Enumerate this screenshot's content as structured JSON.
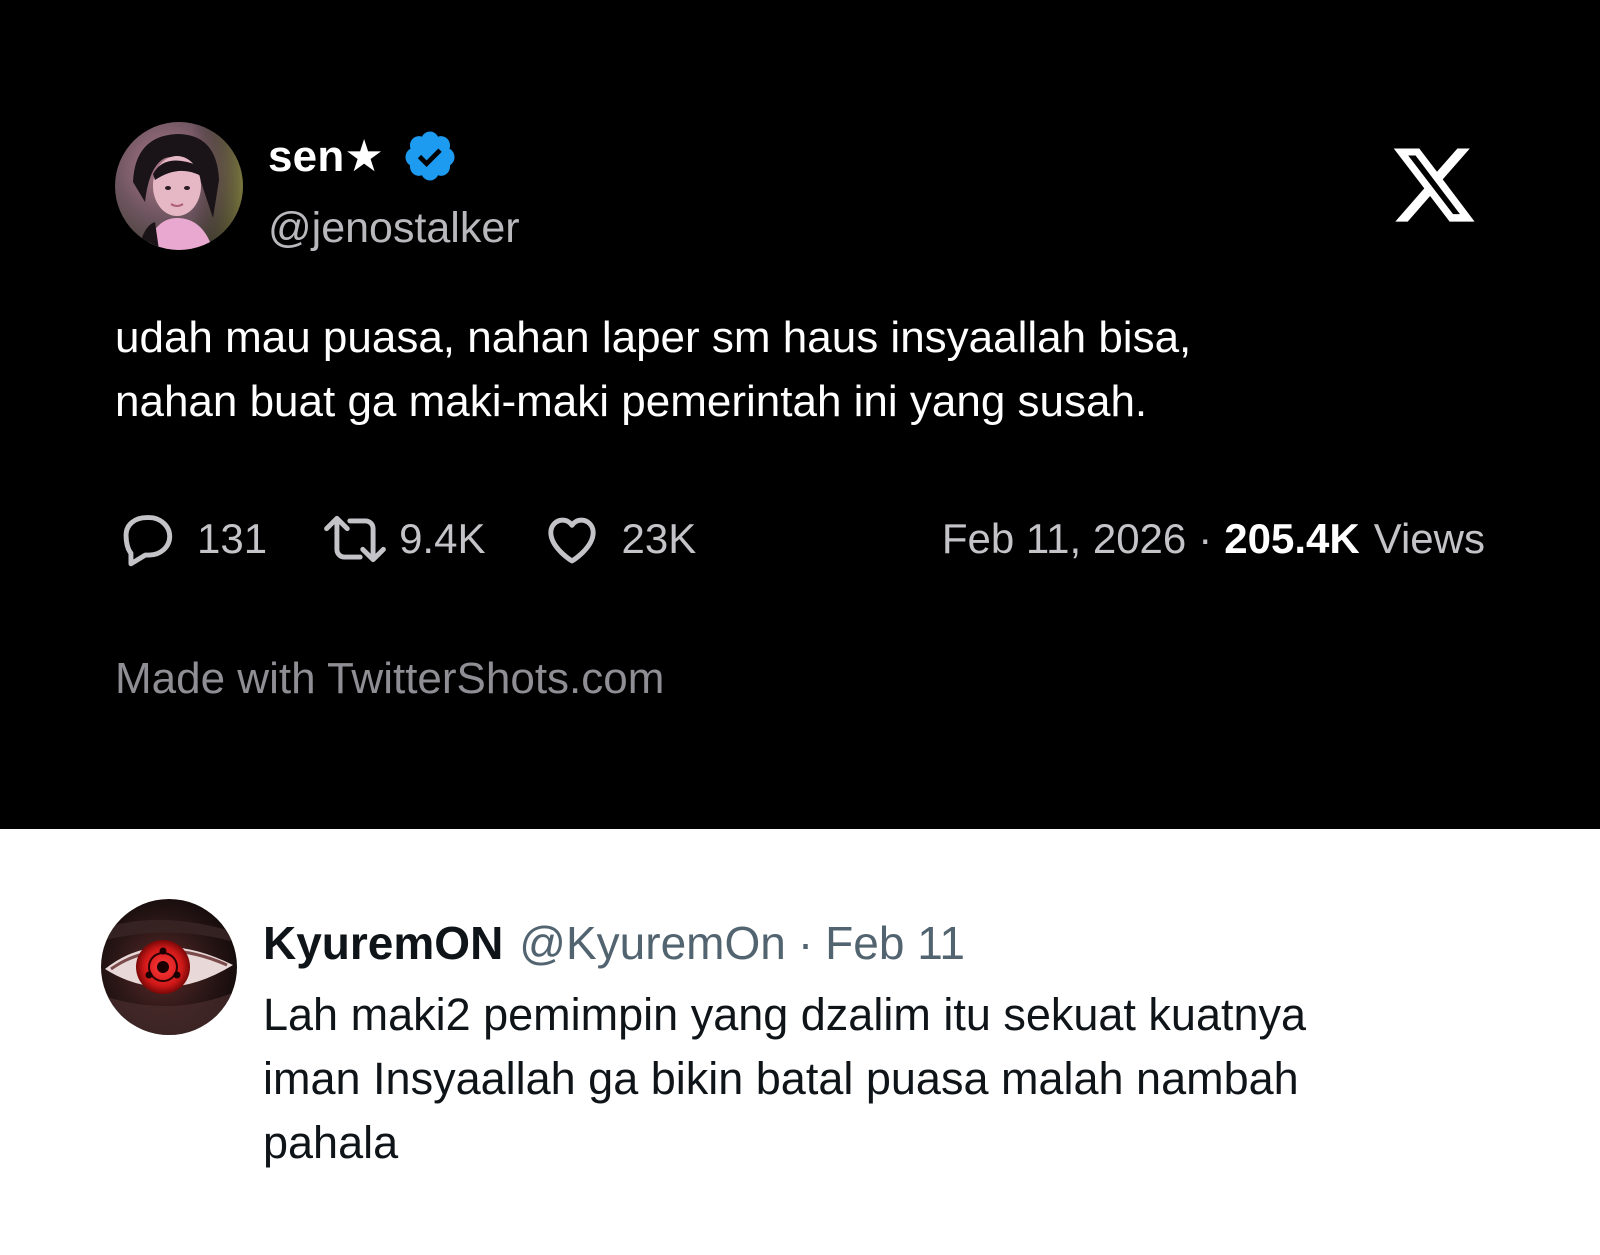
{
  "tweet": {
    "author_name": "sen★",
    "author_handle": "@jenostalker",
    "verified_icon": "verified-badge-icon",
    "platform_logo": "x-logo-icon",
    "text_lines": [
      "udah mau puasa, nahan laper sm haus insyaallah bisa,",
      "nahan buat ga maki-maki pemerintah ini yang susah."
    ],
    "stats": {
      "replies": "131",
      "retweets": "9.4K",
      "likes": "23K"
    },
    "date": "Feb 11, 2026",
    "separator": "·",
    "views_count": "205.4K",
    "views_label": "Views",
    "footer": "Made with TwitterShots.com"
  },
  "reply": {
    "author_name": "KyuremON",
    "author_handle": "@KyuremOn",
    "separator": "·",
    "time": "Feb 11",
    "text_lines": [
      "Lah maki2 pemimpin yang dzalim itu sekuat kuatnya",
      "iman Insyaallah ga bikin batal puasa malah nambah",
      "pahala"
    ]
  },
  "colors": {
    "card_bg": "#000000",
    "verified_blue": "#1d9bf0",
    "muted_text_dark": "#b8b8bd",
    "muted_text_light": "#536471"
  }
}
